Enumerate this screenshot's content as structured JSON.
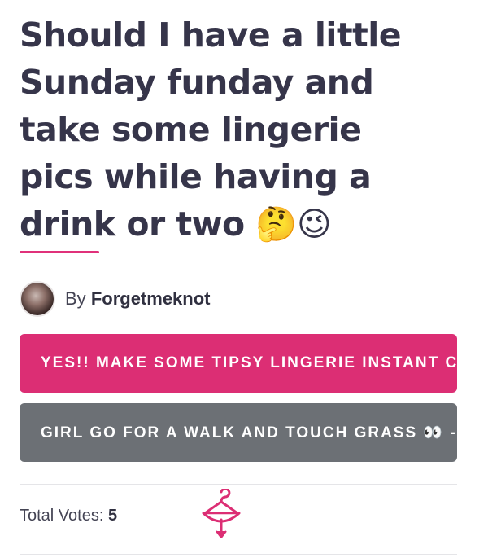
{
  "post": {
    "title": "Should I have a little\nSunday funday and\ntake some lingerie\npics while having a\ndrink or two 🤔😉",
    "author_prefix": "By",
    "author_name": "Forgetmeknot"
  },
  "poll": {
    "options": [
      {
        "label": "YES!! MAKE SOME TIPSY LINGERIE INSTANT C"
      },
      {
        "label": "GIRL GO FOR A WALK AND TOUCH GRASS 👀 -"
      }
    ],
    "total_votes_label": "Total Votes:",
    "total_votes": "5"
  },
  "colors": {
    "accent": "#dc2e74",
    "secondary_button": "#6c7075",
    "title_text": "#36354a"
  },
  "icons": {
    "logo": "hanger-bow-logo-icon"
  }
}
